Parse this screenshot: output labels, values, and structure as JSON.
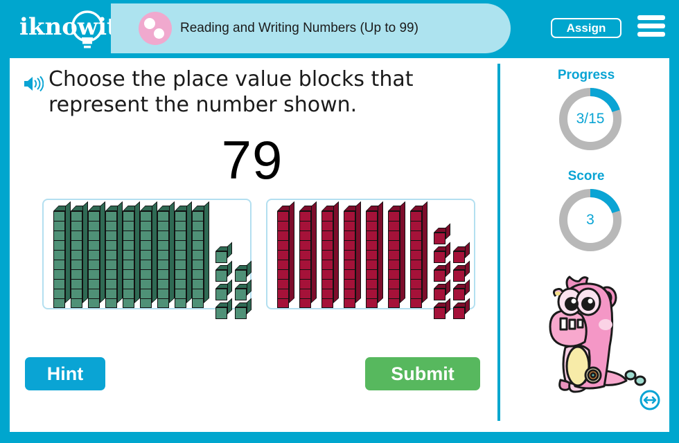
{
  "header": {
    "logo_text": "iknowit",
    "logo_icon": "lightbulb-icon",
    "badge_icon": "dots-badge-icon",
    "title": "Reading and Writing Numbers (Up to 99)",
    "assign_label": "Assign",
    "menu_icon": "hamburger-menu-icon",
    "bar_color": "#00a6ce",
    "pill_color": "#ade3ef",
    "badge_color": "#f0a9ce"
  },
  "question": {
    "speaker_icon": "speaker-audio-icon",
    "text": "Choose the place value blocks that represent the number shown.",
    "number": "79"
  },
  "answers": [
    {
      "id": "option-green",
      "color": "#4f9177",
      "tens": 9,
      "ones": 7,
      "value": 97,
      "selected": false
    },
    {
      "id": "option-red",
      "color": "#a51239",
      "tens": 7,
      "ones": 9,
      "value": 79,
      "selected": false
    }
  ],
  "actions": {
    "hint_label": "Hint",
    "submit_label": "Submit",
    "hint_color": "#0aa4d4",
    "submit_color": "#57b85e"
  },
  "sidebar": {
    "progress_label": "Progress",
    "progress_value": "3/15",
    "progress_percent": 20,
    "score_label": "Score",
    "score_value": "3",
    "score_percent": 20,
    "arc_color": "#0aa4d4",
    "track_color": "#b8b8b8",
    "mascot_icon": "pink-monster-mascot",
    "resize_icon": "resize-arrows-icon"
  }
}
